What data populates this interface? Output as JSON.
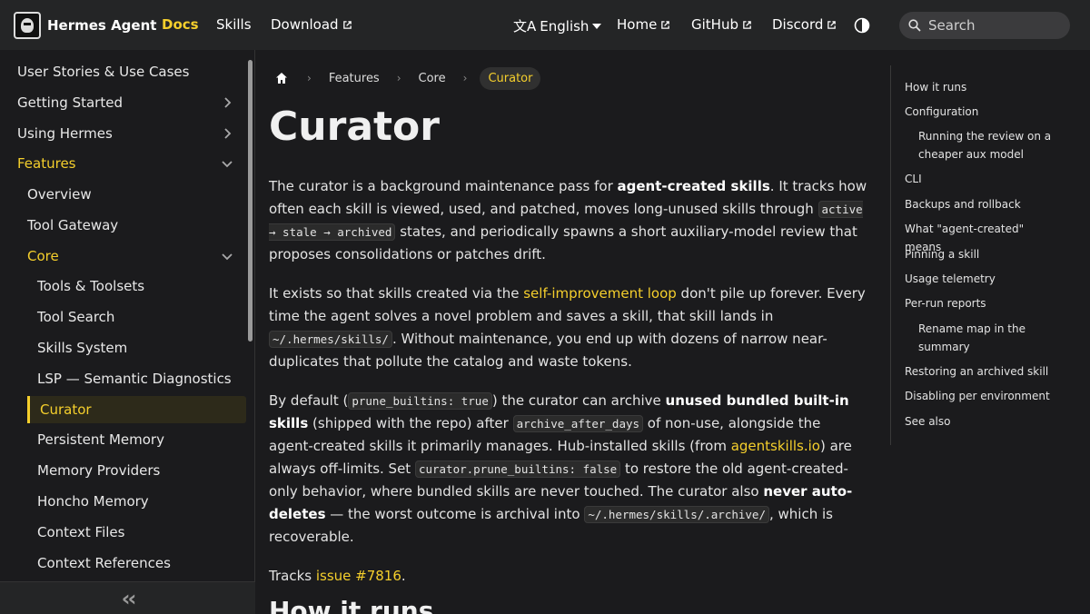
{
  "navbar": {
    "brand": "Hermes Agent",
    "links": [
      {
        "label": "Docs",
        "active": true
      },
      {
        "label": "Skills"
      },
      {
        "label": "Download",
        "external": true
      }
    ],
    "right_links": [
      {
        "label": "English"
      },
      {
        "label": "Home"
      },
      {
        "label": "GitHub"
      },
      {
        "label": "Discord"
      }
    ],
    "search_placeholder": "Search"
  },
  "sidebar": {
    "items": [
      {
        "label": "User Stories & Use Cases"
      },
      {
        "label": "Getting Started"
      },
      {
        "label": "Using Hermes"
      },
      {
        "label": "Features"
      },
      {
        "label": "Overview"
      },
      {
        "label": "Tool Gateway"
      },
      {
        "label": "Core"
      },
      {
        "label": "Tools & Toolsets"
      },
      {
        "label": "Tool Search"
      },
      {
        "label": "Skills System"
      },
      {
        "label": "LSP — Semantic Diagnostics"
      },
      {
        "label": "Curator"
      },
      {
        "label": "Persistent Memory"
      },
      {
        "label": "Memory Providers"
      },
      {
        "label": "Honcho Memory"
      },
      {
        "label": "Context Files"
      },
      {
        "label": "Context References"
      }
    ]
  },
  "breadcrumbs": [
    "Features",
    "Core",
    "Curator"
  ],
  "page": {
    "title": "Curator",
    "p1": {
      "t1": "The curator is a background maintenance pass for ",
      "b1": "agent-created skills",
      "t2": ". It tracks how often each skill is viewed, used, and patched, moves long-unused skills through ",
      "c1": "active → stale → archived",
      "t3": " states, and periodically spawns a short auxiliary-model review that proposes consolidations or patches drift."
    },
    "p2": {
      "t1": "It exists so that skills created via the ",
      "l1": "self-improvement loop",
      "t2": " don't pile up forever. Every time the agent solves a novel problem and saves a skill, that skill lands in ",
      "c1": "~/.hermes/skills/",
      "t3": ". Without maintenance, you end up with dozens of narrow near-duplicates that pollute the catalog and waste tokens."
    },
    "p3": {
      "t1": "By default (",
      "c1": "prune_builtins: true",
      "t2": ") the curator can archive ",
      "b1": "unused bundled built-in skills",
      "t3": " (shipped with the repo) after ",
      "c2": "archive_after_days",
      "t4": " of non-use, alongside the agent-created skills it primarily manages. Hub-installed skills (from ",
      "l1": "agentskills.io",
      "t5": ") are always off-limits. Set ",
      "c3": "curator.prune_builtins: false",
      "t6": " to restore the old agent-created-only behavior, where bundled skills are never touched. The curator also ",
      "b2": "never auto-deletes",
      "t7": " — the worst outcome is archival into ",
      "c4": "~/.hermes/skills/.archive/",
      "t8": ", which is recoverable."
    },
    "p4": {
      "t1": "Tracks ",
      "l1": "issue #7816",
      "t2": "."
    },
    "subtitle": "How it runs"
  },
  "toc": {
    "items": [
      {
        "label": "How it runs"
      },
      {
        "label": "Configuration"
      },
      {
        "label": "Running the review on a cheaper aux model"
      },
      {
        "label": "CLI"
      },
      {
        "label": "Backups and rollback"
      },
      {
        "label": "What \"agent-created\" means"
      },
      {
        "label": "Pinning a skill"
      },
      {
        "label": "Usage telemetry"
      },
      {
        "label": "Per-run reports"
      },
      {
        "label": "Rename map in the summary"
      },
      {
        "label": "Restoring an archived skill"
      },
      {
        "label": "Disabling per environment"
      },
      {
        "label": "See also"
      }
    ]
  },
  "colors": {
    "accent": "#f5cf2c",
    "navbar_bg": "#242526",
    "page_bg": "#1b1b1d"
  },
  "icons": [
    "hermes-logo-icon",
    "translate-icon",
    "external-link-icon",
    "theme-toggle-icon",
    "search-icon",
    "home-icon",
    "chevron-right-icon",
    "chevron-down-icon",
    "double-chevron-left-icon"
  ]
}
